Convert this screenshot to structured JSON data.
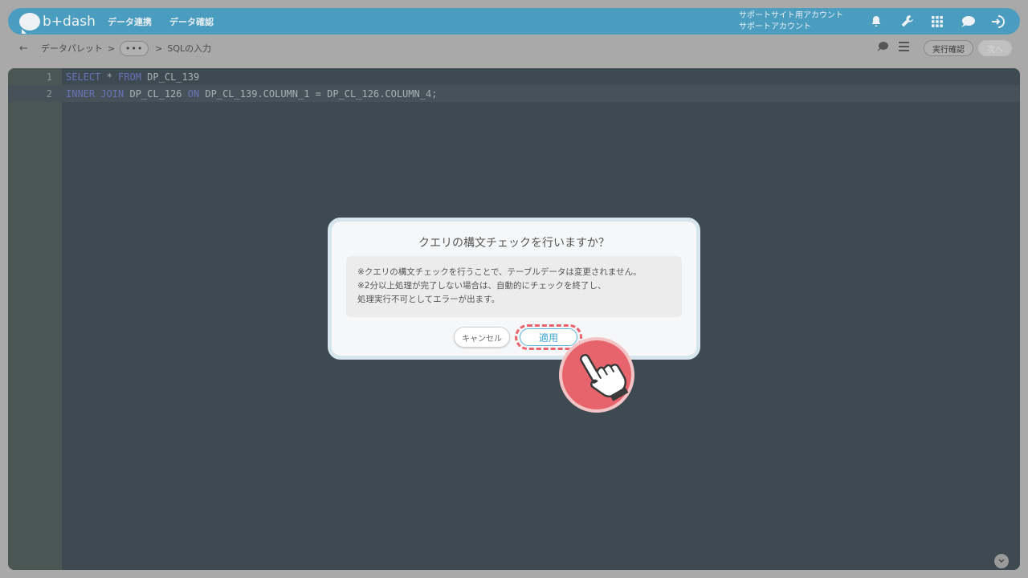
{
  "header": {
    "logo_text": "b+dash",
    "nav": [
      "データ連携",
      "データ確認"
    ],
    "account_line1": "サポートサイト用アカウント",
    "account_line2": "サポートアカウント",
    "icons": [
      "bell-icon",
      "wrench-icon",
      "grid-icon",
      "chat-icon",
      "logout-icon"
    ]
  },
  "breadcrumb": {
    "item1": "データパレット",
    "sep": ">",
    "ellipsis": "•••",
    "item2": "SQLの入力",
    "exec_label": "実行確認",
    "next_label": "次へ"
  },
  "editor": {
    "lines": [
      {
        "num": "1",
        "kw1": "SELECT",
        "rest1": " * ",
        "kw2": "FROM",
        "rest2": " DP_CL_139"
      },
      {
        "num": "2",
        "kw1": "INNER JOIN",
        "rest1": " DP_CL_126 ",
        "kw2": "ON",
        "rest2": " DP_CL_139.COLUMN_1 = DP_CL_126.COLUMN_4;"
      }
    ]
  },
  "modal": {
    "title": "クエリの構文チェックを行いますか？",
    "line1": "※クエリの構文チェックを行うことで、テーブルデータは変更されません。",
    "line2": "※2分以上処理が完了しない場合は、自動的にチェックを終了し、",
    "line3": "処理実行不可としてエラーが出ます。",
    "cancel": "キャンセル",
    "apply": "適用"
  },
  "colors": {
    "header": "#4a9dbf",
    "editor_bg": "#3d4a51",
    "highlight": "#e8646c",
    "apply_text": "#3ea3d2"
  }
}
